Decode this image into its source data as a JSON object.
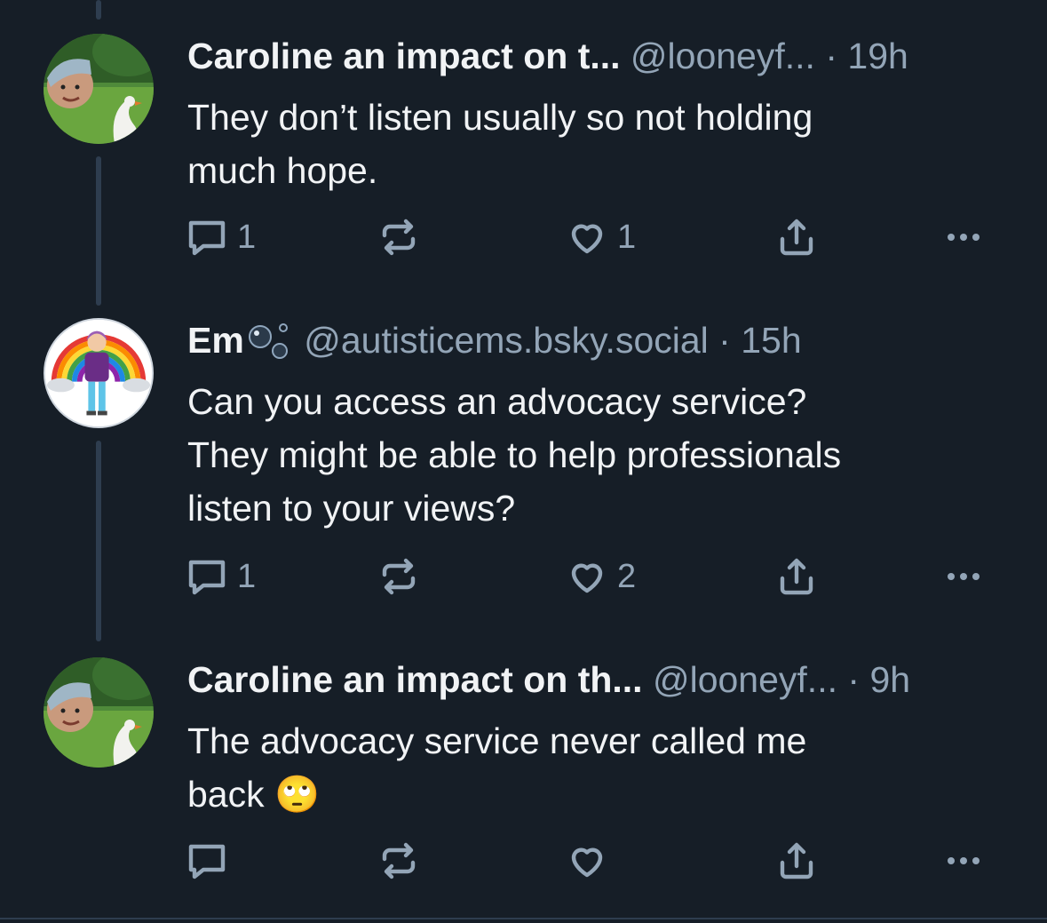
{
  "posts": [
    {
      "author": "Caroline an impact on t...",
      "handle": "@looneyf...",
      "separator": "·",
      "time": "19h",
      "text": "They don’t listen usually so not holding\nmuch hope.",
      "replies": "1",
      "reposts": "",
      "likes": "1"
    },
    {
      "author": "Em",
      "handle": "@autisticems.bsky.social",
      "separator": "·",
      "time": "15h",
      "text": "Can you access an advocacy service?\nThey might be able to help professionals\nlisten to your views?",
      "replies": "1",
      "reposts": "",
      "likes": "2"
    },
    {
      "author": "Caroline an impact on th...",
      "handle": "@looneyf...",
      "separator": "·",
      "time": "9h",
      "text": "The advocacy service never called me\nback",
      "emoji": "🙄",
      "replies": "",
      "reposts": "",
      "likes": ""
    }
  ],
  "icons": {
    "reply": "reply-icon",
    "repost": "repost-icon",
    "like": "heart-icon",
    "share": "share-icon",
    "more": "more-icon"
  },
  "colors": {
    "background": "#161e27",
    "text": "#f1f3f5",
    "muted": "#93a5b7",
    "thread_line": "#2e3d4f"
  }
}
